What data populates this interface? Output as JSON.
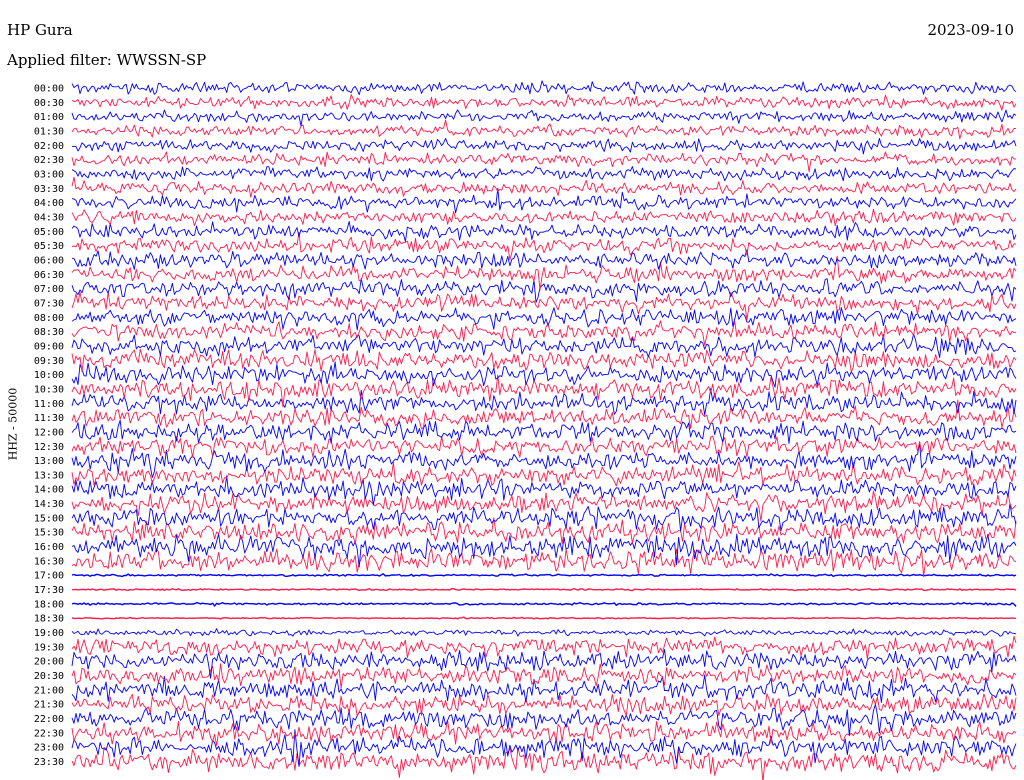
{
  "header": {
    "station": "HP Gura",
    "filter": "Applied filter: WWSSN-SP",
    "date": "2023-09-10"
  },
  "chart_data": {
    "type": "line",
    "title": "HP Gura",
    "subtitle": "Applied filter: WWSSN-SP",
    "date": "2023-09-10",
    "ylabel": "HHZ - 50000",
    "row_interval_minutes": 30,
    "series_colors": [
      "#0000ff",
      "#ff1a4a"
    ],
    "rows": [
      {
        "time": "00:00",
        "amplitude": 0.55
      },
      {
        "time": "00:30",
        "amplitude": 0.55
      },
      {
        "time": "01:00",
        "amplitude": 0.55
      },
      {
        "time": "01:30",
        "amplitude": 0.55
      },
      {
        "time": "02:00",
        "amplitude": 0.6
      },
      {
        "time": "02:30",
        "amplitude": 0.6
      },
      {
        "time": "03:00",
        "amplitude": 0.6
      },
      {
        "time": "03:30",
        "amplitude": 0.6
      },
      {
        "time": "04:00",
        "amplitude": 0.65
      },
      {
        "time": "04:30",
        "amplitude": 0.65
      },
      {
        "time": "05:00",
        "amplitude": 0.7
      },
      {
        "time": "05:30",
        "amplitude": 0.7
      },
      {
        "time": "06:00",
        "amplitude": 0.75
      },
      {
        "time": "06:30",
        "amplitude": 0.75
      },
      {
        "time": "07:00",
        "amplitude": 0.8
      },
      {
        "time": "07:30",
        "amplitude": 0.8
      },
      {
        "time": "08:00",
        "amplitude": 0.85
      },
      {
        "time": "08:30",
        "amplitude": 0.85
      },
      {
        "time": "09:00",
        "amplitude": 0.85
      },
      {
        "time": "09:30",
        "amplitude": 0.9
      },
      {
        "time": "10:00",
        "amplitude": 0.9
      },
      {
        "time": "10:30",
        "amplitude": 0.9
      },
      {
        "time": "11:00",
        "amplitude": 0.9
      },
      {
        "time": "11:30",
        "amplitude": 0.9
      },
      {
        "time": "12:00",
        "amplitude": 0.9
      },
      {
        "time": "12:30",
        "amplitude": 0.9
      },
      {
        "time": "13:00",
        "amplitude": 0.9
      },
      {
        "time": "13:30",
        "amplitude": 0.9
      },
      {
        "time": "14:00",
        "amplitude": 0.9
      },
      {
        "time": "14:30",
        "amplitude": 0.95
      },
      {
        "time": "15:00",
        "amplitude": 1.0
      },
      {
        "time": "15:30",
        "amplitude": 1.0
      },
      {
        "time": "16:00",
        "amplitude": 1.05
      },
      {
        "time": "16:30",
        "amplitude": 1.1
      },
      {
        "time": "17:00",
        "amplitude": 0.1
      },
      {
        "time": "17:30",
        "amplitude": 0.08
      },
      {
        "time": "18:00",
        "amplitude": 0.1
      },
      {
        "time": "18:30",
        "amplitude": 0.06
      },
      {
        "time": "19:00",
        "amplitude": 0.3
      },
      {
        "time": "19:30",
        "amplitude": 0.85
      },
      {
        "time": "20:00",
        "amplitude": 0.9
      },
      {
        "time": "20:30",
        "amplitude": 0.9
      },
      {
        "time": "21:00",
        "amplitude": 0.95
      },
      {
        "time": "21:30",
        "amplitude": 0.95
      },
      {
        "time": "22:00",
        "amplitude": 0.95
      },
      {
        "time": "22:30",
        "amplitude": 1.0
      },
      {
        "time": "23:00",
        "amplitude": 1.0
      },
      {
        "time": "23:30",
        "amplitude": 1.05
      }
    ]
  }
}
